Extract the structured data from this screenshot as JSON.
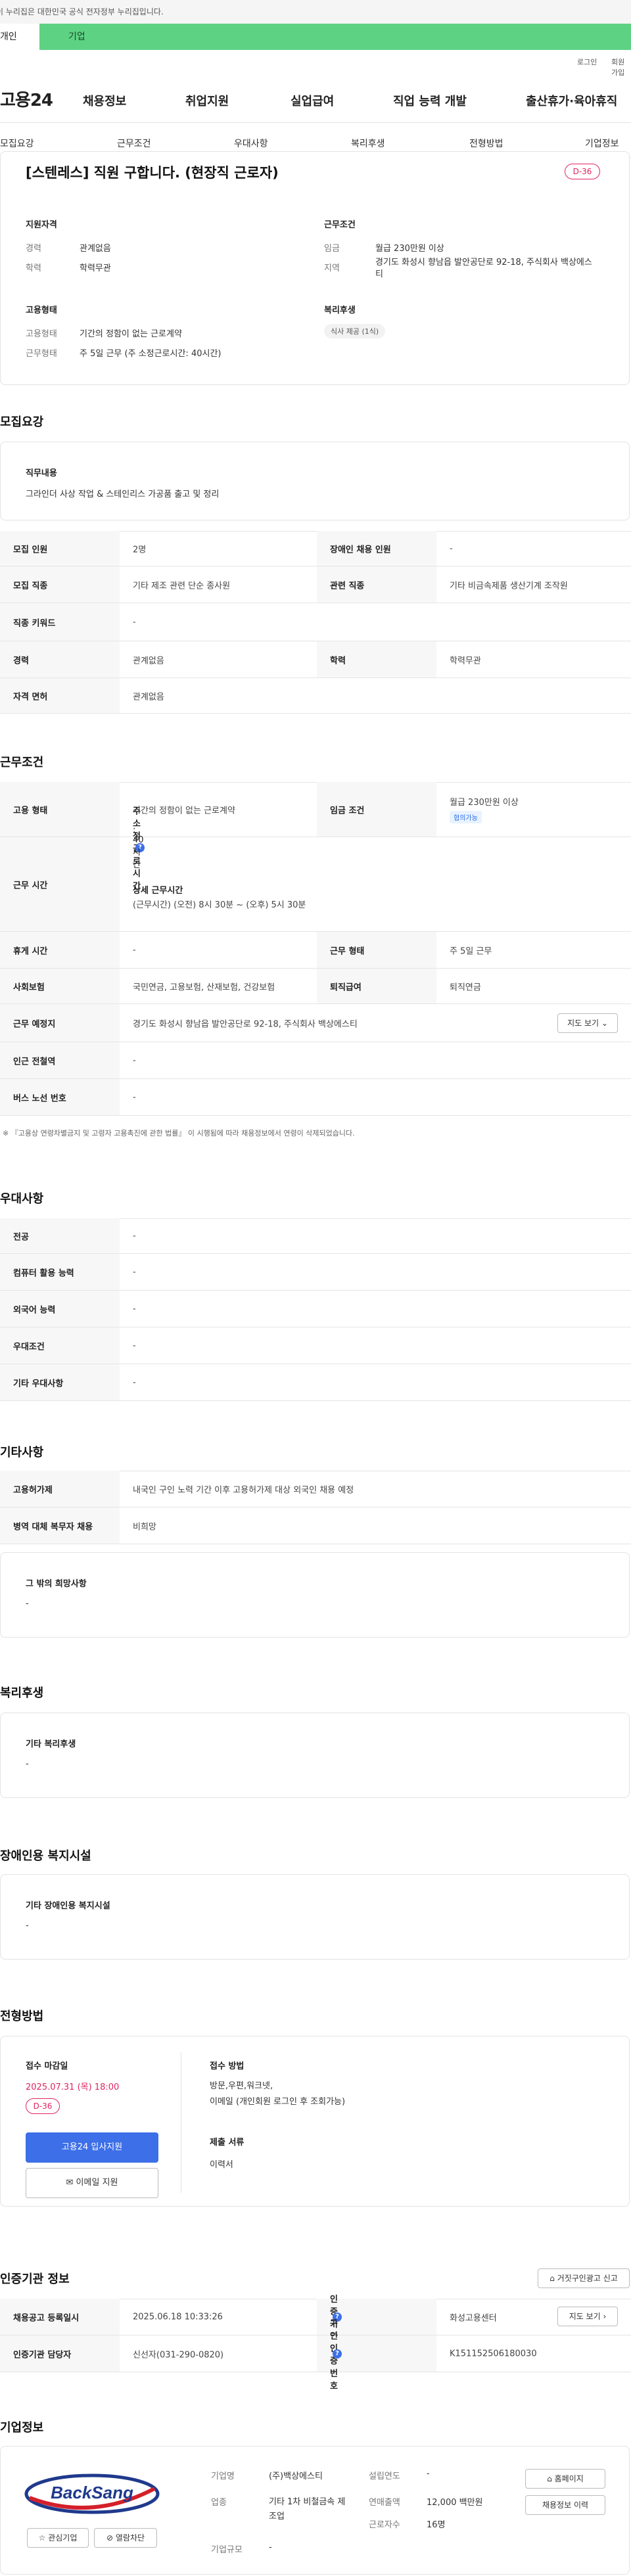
{
  "gov_bar": "이 누리집은 대한민국 공식 전자정부 누리집입니다.",
  "tabs": {
    "personal": "개인",
    "company": "기업"
  },
  "util": {
    "login": "로그인",
    "signup": "회원가입"
  },
  "brand": "고용24",
  "gnb": [
    "채용정보",
    "취업지원",
    "실업급여",
    "직업 능력 개발",
    "출산휴가·육아휴직"
  ],
  "snb": [
    "모집요강",
    "근무조건",
    "우대사항",
    "복리후생",
    "전형방법",
    "기업정보"
  ],
  "summary": {
    "title": "[스텐레스] 직원 구합니다. (현장직 근로자)",
    "dday": "D-36",
    "qual_heading": "지원자격",
    "career_label": "경력",
    "career": "관계없음",
    "edu_label": "학력",
    "edu": "학력무관",
    "cond_heading": "근무조건",
    "wage_label": "임금",
    "wage": "월급 230만원 이상",
    "region_label": "지역",
    "region": "경기도 화성시 향남읍 발안공단로 92-18, 주식회사 백상에스티",
    "emp_heading": "고용형태",
    "emptype_label": "고용형태",
    "emptype": "기간의 정함이 없는 근로계약",
    "worktype_label": "근무형태",
    "worktype": "주 5일 근무 (주 소정근로시간: 40시간)",
    "welfare_heading": "복리후생",
    "welfare_chip": "식사 제공 (1식)"
  },
  "recruit": {
    "title": "모집요강",
    "duty_heading": "직무내용",
    "duty": "그라인더 사상 작업 & 스테인리스 가공품 출고 및 정리",
    "rows": [
      {
        "l1": "모집 인원",
        "v1": "2명",
        "l2": "장애인 채용 인원",
        "v2": "-"
      },
      {
        "l1": "모집 직종",
        "v1": "기타 제조 관련 단순 종사원",
        "l2": "관련 직종",
        "v2": "기타 비금속제품 생산기계 조작원"
      },
      {
        "l1": "직종 키워드",
        "v1": "-"
      },
      {
        "l1": "경력",
        "v1": "관계없음",
        "l2": "학력",
        "v2": "학력무관"
      },
      {
        "l1": "자격 면허",
        "v1": "관계없음"
      }
    ]
  },
  "work": {
    "title": "근무조건",
    "emptype_label": "고용 형태",
    "emptype": "기간의 정함이 없는 근로계약",
    "wage_label": "임금 조건",
    "wage": "월급 230만원 이상",
    "wage_badge": "협의가능",
    "hours_label": "근무 시간",
    "hours_main": "주 소정근로시간",
    "hours_main_val": ": 40시간",
    "hours_detail_h": "상세 근무시간",
    "hours_detail": "(근무시간) (오전) 8시 30분 ~ (오후) 5시 30분",
    "rest_label": "휴게 시간",
    "rest": "-",
    "form_label": "근무 형태",
    "form": "주 5일 근무",
    "ins_label": "사회보험",
    "ins": "국민연금, 고용보험, 산재보험, 건강보험",
    "sev_label": "퇴직급여",
    "sev": "퇴직연금",
    "place_label": "근무 예정지",
    "place": "경기도 화성시 향남읍 발안공단로 92-18, 주식회사 백상에스티",
    "map_btn": "지도 보기",
    "station_label": "인근 전철역",
    "station": "-",
    "bus_label": "버스 노선 번호",
    "bus": "-",
    "note": "※ 『고용상 연령차별금지 및 고령자 고용촉진에 관한 법률』 이 시행됨에 따라 채용정보에서 연령이 삭제되었습니다."
  },
  "pref": {
    "title": "우대사항",
    "rows": [
      {
        "l": "전공",
        "v": "-"
      },
      {
        "l": "컴퓨터 활용 능력",
        "v": "-"
      },
      {
        "l": "외국어 능력",
        "v": "-"
      },
      {
        "l": "우대조건",
        "v": "-"
      },
      {
        "l": "기타 우대사항",
        "v": "-"
      }
    ]
  },
  "etc": {
    "title": "기타사항",
    "rows": [
      {
        "l": "고용허가제",
        "v": "내국인 구인 노력 기간 이후 고용허가제 대상 외국인 채용 예정"
      },
      {
        "l": "병역 대체 복무자 채용",
        "v": "비희망"
      }
    ],
    "other_h": "그 밖의 희망사항",
    "other_v": "-"
  },
  "welfare": {
    "title": "복리후생",
    "h": "기타 복리후생",
    "v": "-"
  },
  "disabled": {
    "title": "장애인용 복지시설",
    "h": "기타 장애인용 복지시설",
    "v": "-"
  },
  "process": {
    "title": "전형방법",
    "deadline_h": "접수 마감일",
    "deadline": "2025.07.31 (목) 18:00",
    "dday": "D-36",
    "apply_btn": "고용24 입사지원",
    "email_btn": "이메일 지원",
    "method_h": "접수 방법",
    "method": "방문,우편,워크넷,",
    "method2": "이메일 (개인회원 로그인 후 조회가능)",
    "docs_h": "제출 서류",
    "docs": "이력서"
  },
  "agency": {
    "title": "인증기관 정보",
    "report_btn": "거짓구인광고 신고",
    "reg_label": "채용공고 등록일시",
    "reg": "2025.06.18 10:33:26",
    "org_label": "인증기관",
    "org": "화성고용센터",
    "map_btn": "지도 보기",
    "mgr_label": "인증기관 담당자",
    "mgr": "신선자(031-290-0820)",
    "no_label": "구인인증번호",
    "no": "K151152506180030"
  },
  "company": {
    "title": "기업정보",
    "logo_text": "BackSang",
    "interest_btn": "관심기업",
    "block_btn": "열람차단",
    "name_label": "기업명",
    "name": "(주)백상에스티",
    "industry_label": "업종",
    "industry": "기타 1차 비철금속 제조업",
    "size_label": "기업규모",
    "size": "-",
    "founded_label": "설립연도",
    "founded": "-",
    "sales_label": "연매출액",
    "sales": "12,000 백만원",
    "emp_label": "근로자수",
    "emp": "16명",
    "home_btn": "홈페이지",
    "history_btn": "채용정보 이력"
  }
}
